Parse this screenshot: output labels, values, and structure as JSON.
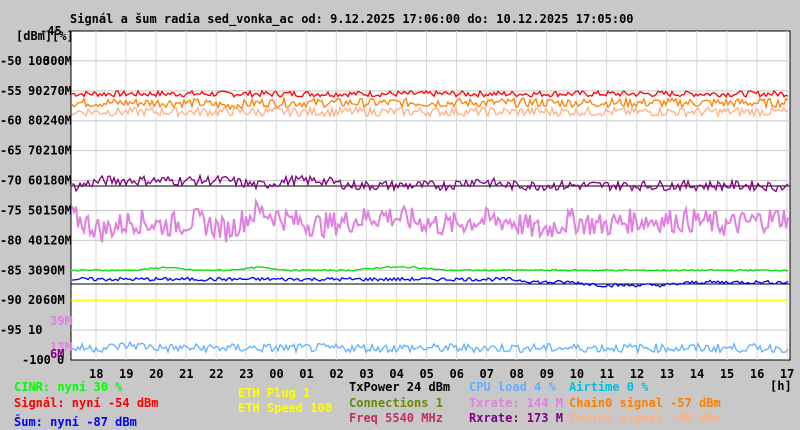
{
  "title": "Signál a šum radia sed_vonka_ac od: 9.12.2025 17:06:00 do: 10.12.2025 17:05:00",
  "chart_data": {
    "type": "line",
    "title": "Signál a šum radia sed_vonka_ac od: 9.12.2025 17:06:00 do: 10.12.2025 17:05:00",
    "ylabel_units": [
      "[dBm]",
      "[%]"
    ],
    "xlabel": "[h]",
    "ylim": [
      -100,
      -45
    ],
    "yticks_dbm": [
      "-45",
      "-50",
      "-55",
      "-60",
      "-65",
      "-70",
      "-75",
      "-80",
      "-85",
      "-90",
      "-95",
      "-100"
    ],
    "yticks_pct": [
      "100",
      "90",
      "80",
      "70",
      "60",
      "50",
      "40",
      "30",
      "20",
      "10",
      "0"
    ],
    "yticks_rate": [
      "300M",
      "270M",
      "240M",
      "210M",
      "180M",
      "150M",
      "120M",
      "90M",
      "60M"
    ],
    "rate_markers": [
      {
        "label": "39M",
        "color": "#e080e0",
        "value": 39
      },
      {
        "label": "13M",
        "color": "#e080e0",
        "value": 13
      },
      {
        "label": "6M",
        "color": "#800080",
        "value": 6
      }
    ],
    "xticks": [
      "18",
      "19",
      "20",
      "21",
      "22",
      "23",
      "00",
      "01",
      "02",
      "03",
      "04",
      "05",
      "06",
      "07",
      "08",
      "09",
      "10",
      "11",
      "12",
      "13",
      "14",
      "15",
      "16",
      "17"
    ],
    "grid": true,
    "series": [
      {
        "name": "Signál",
        "unit": "dBm",
        "color": "#ff0000",
        "values": [
          -55.5,
          -55.5,
          -55.5,
          -55.5,
          -55.5,
          -55.5,
          -55.5,
          -55.5,
          -55.5,
          -55.5,
          -55.5,
          -55.5,
          -55.5,
          -55.5,
          -55.5,
          -55.5,
          -55.5,
          -55.5,
          -55.5,
          -55.5,
          -55.5,
          -55.5,
          -55.5,
          -55.5
        ]
      },
      {
        "name": "Chain0 signal",
        "unit": "dBm",
        "color": "#ff8000",
        "values": [
          -57,
          -57,
          -57,
          -57,
          -57,
          -57.5,
          -57,
          -57,
          -57,
          -57,
          -57,
          -57,
          -57,
          -57,
          -57,
          -57,
          -57,
          -57,
          -57,
          -57,
          -57,
          -57,
          -57,
          -57
        ]
      },
      {
        "name": "Chain1 signal",
        "unit": "dBm",
        "color": "#ffb080",
        "values": [
          -58.5,
          -58.5,
          -58.5,
          -58.5,
          -58.5,
          -58.5,
          -58.5,
          -58.5,
          -58.5,
          -58.5,
          -58.5,
          -58.5,
          -58.5,
          -58.5,
          -58.5,
          -58.5,
          -58.5,
          -58.5,
          -58.5,
          -58.5,
          -58.5,
          -58.5,
          -58.5,
          -58.5
        ]
      },
      {
        "name": "Txrate",
        "unit": "M",
        "color": "#e080e0",
        "values": [
          144,
          130,
          140,
          135,
          140,
          130,
          150,
          140,
          135,
          140,
          145,
          140,
          135,
          140,
          140,
          130,
          140,
          135,
          140,
          140,
          140,
          135,
          140,
          144
        ]
      },
      {
        "name": "Rxrate",
        "unit": "M",
        "color": "#800080",
        "values": [
          173,
          180,
          180,
          180,
          180,
          180,
          175,
          180,
          180,
          175,
          175,
          175,
          175,
          180,
          175,
          175,
          175,
          175,
          175,
          175,
          175,
          175,
          175,
          173
        ]
      },
      {
        "name": "CINR",
        "unit": "%",
        "color": "#00e000",
        "values": [
          30,
          30,
          30,
          31,
          30,
          30,
          31,
          30,
          30,
          30,
          31,
          31,
          30,
          30,
          30,
          30,
          30,
          30,
          30,
          30,
          30,
          30,
          30,
          30
        ]
      },
      {
        "name": "Šum",
        "unit": "dBm",
        "color": "#0000ff",
        "values": [
          -86.5,
          -86.5,
          -86.5,
          -86.5,
          -86.5,
          -86.5,
          -86.5,
          -86.5,
          -86.5,
          -86.5,
          -86.5,
          -86.5,
          -86.5,
          -86.5,
          -86.5,
          -87,
          -87,
          -87.5,
          -87.5,
          -87.5,
          -87,
          -87,
          -87,
          -87
        ]
      },
      {
        "name": "CPU load",
        "unit": "%",
        "color": "#60b0ff",
        "values": [
          4,
          4,
          5,
          4,
          4,
          4,
          4,
          4,
          4,
          4,
          4,
          4,
          4,
          4,
          4,
          4,
          4,
          4,
          4,
          4,
          4,
          4,
          4,
          4
        ]
      },
      {
        "name": "ETH Speed",
        "unit": "",
        "color": "#ffff00",
        "values": [
          100,
          100,
          100,
          100,
          100,
          100,
          100,
          100,
          100,
          100,
          100,
          100,
          100,
          100,
          100,
          100,
          100,
          100,
          100,
          100,
          100,
          100,
          100,
          100
        ]
      }
    ]
  },
  "legend": {
    "cinr": {
      "text": "CINR: nyní 30 %",
      "color": "#00ff00"
    },
    "signal": {
      "text": "Signál: nyní -54 dBm",
      "color": "#ff0000"
    },
    "noise": {
      "text": "Šum: nyní -87 dBm",
      "color": "#0000ff"
    },
    "eth_plug": {
      "text": "ETH Plug 1",
      "color": "#ffff00"
    },
    "eth_speed": {
      "text": "ETH Speed 100",
      "color": "#ffff00"
    },
    "txpower": {
      "text": "TxPower 24 dBm",
      "color": "#000000"
    },
    "connections_label": {
      "text": "Connections",
      "color": "#6a8a00"
    },
    "connections_value": {
      "text": "1",
      "color": "#6a8a00"
    },
    "freq": {
      "text": "Freq 5540 MHz",
      "color": "#c03060"
    },
    "cpu": {
      "text": "CPU load 4 %",
      "color": "#60b0ff"
    },
    "txrate": {
      "text": "Txrate: 144 M",
      "color": "#e080e0"
    },
    "rxrate": {
      "text": "Rxrate: 173 M",
      "color": "#800080"
    },
    "airtime": {
      "text": "Airtime 0 %",
      "color": "#00c0e0"
    },
    "chain0": {
      "text": "Chain0 signal -57 dBm",
      "color": "#ff8000"
    },
    "chain1": {
      "text": "Chain1 signal -58 dBm",
      "color": "#ffb080"
    }
  }
}
